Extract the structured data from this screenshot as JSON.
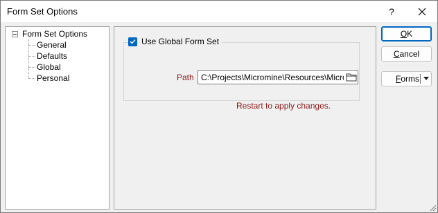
{
  "window": {
    "title": "Form Set Options"
  },
  "titlebar": {
    "help_label": "?"
  },
  "tree": {
    "root_label": "Form Set Options",
    "items": [
      {
        "label": "General"
      },
      {
        "label": "Defaults"
      },
      {
        "label": "Global"
      },
      {
        "label": "Personal"
      }
    ]
  },
  "global_form_set": {
    "checkbox_label": "Use Global Form Set",
    "checked": true,
    "path_label": "Path",
    "path_value": "C:\\Projects\\Micromine\\Resources\\Micromine\\",
    "restart_message": "Restart to apply changes."
  },
  "buttons": {
    "ok_accel": "O",
    "ok_rest": "K",
    "cancel_accel": "C",
    "cancel_rest": "ancel",
    "forms_accel": "F",
    "forms_rest": "orms"
  },
  "colors": {
    "accent": "#0067c0",
    "message_red": "#8b1a1a"
  }
}
